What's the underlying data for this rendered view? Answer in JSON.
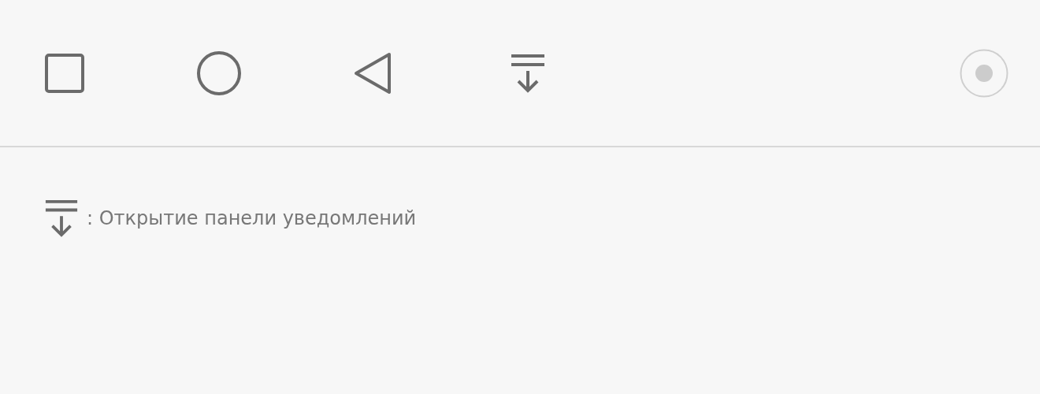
{
  "nav_bar": {
    "buttons": [
      {
        "kind": "recents"
      },
      {
        "kind": "home"
      },
      {
        "kind": "back"
      },
      {
        "kind": "notifications"
      }
    ],
    "floating_button": {
      "kind": "assistive"
    }
  },
  "legend": [
    {
      "kind": "notifications",
      "text": ": Открытие панели уведомлений"
    }
  ]
}
